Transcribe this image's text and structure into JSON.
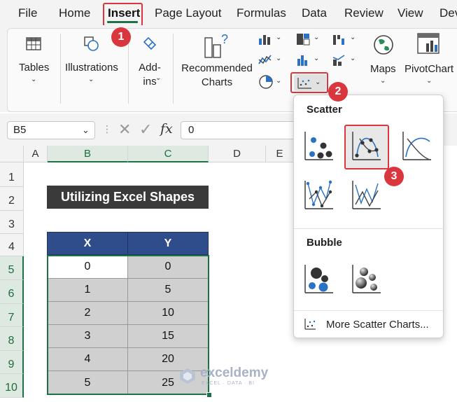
{
  "menubar": {
    "tabs": [
      "File",
      "Home",
      "Insert",
      "Page Layout",
      "Formulas",
      "Data",
      "Review",
      "View",
      "Dev"
    ],
    "active_tab": "Insert"
  },
  "ribbon": {
    "tables": "Tables",
    "illustrations": "Illustrations",
    "addins": "Add-ins",
    "recommended_charts": "Recommended Charts",
    "maps": "Maps",
    "pivotchart": "PivotChart"
  },
  "formula_bar": {
    "name_box": "B5",
    "fx": "fx",
    "value": "0"
  },
  "columns": [
    "A",
    "B",
    "C",
    "D",
    "E"
  ],
  "rows": [
    "1",
    "2",
    "3",
    "4",
    "5",
    "6",
    "7",
    "8",
    "9",
    "10"
  ],
  "sheet": {
    "title": "Utilizing Excel Shapes",
    "headers": [
      "X",
      "Y"
    ],
    "data": [
      [
        "0",
        "0"
      ],
      [
        "1",
        "5"
      ],
      [
        "2",
        "10"
      ],
      [
        "3",
        "15"
      ],
      [
        "4",
        "20"
      ],
      [
        "5",
        "25"
      ]
    ]
  },
  "dropdown": {
    "scatter_heading": "Scatter",
    "bubble_heading": "Bubble",
    "more": "More Scatter Charts..."
  },
  "annotations": {
    "step1": "1",
    "step2": "2",
    "step3": "3"
  },
  "watermark": {
    "brand": "exceldemy",
    "tagline": "EXCEL · DATA · BI"
  },
  "colors": {
    "excel_green": "#1e7145",
    "header_blue": "#2f4d8a",
    "title_dark": "#3a3a3a",
    "callout_red": "#d9363e"
  }
}
